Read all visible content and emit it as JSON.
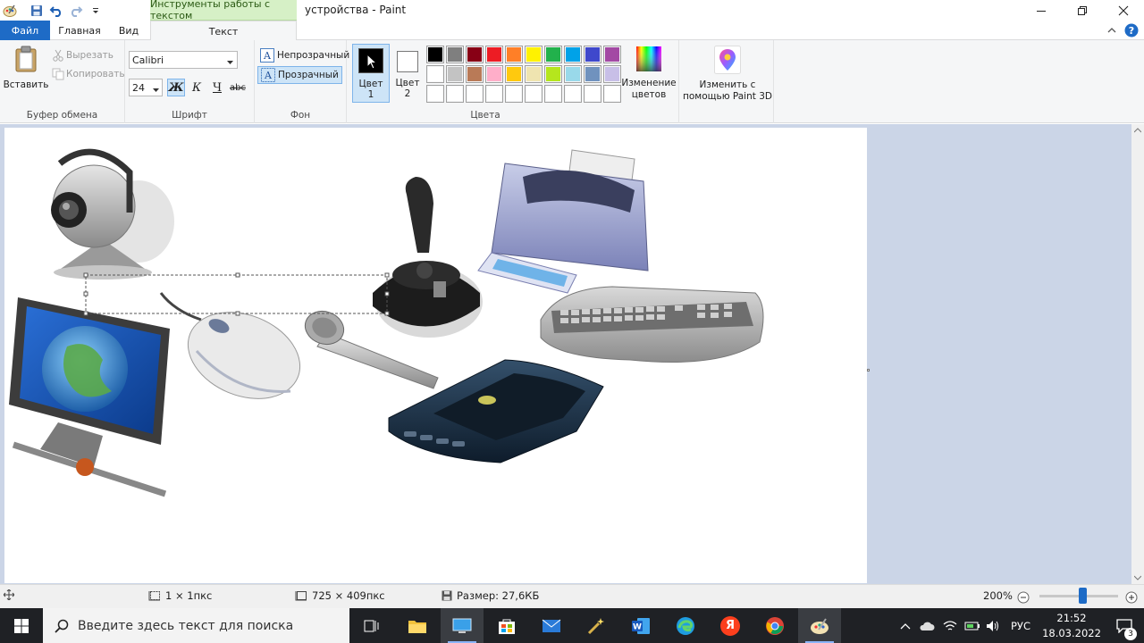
{
  "titlebar": {
    "context_tab_title": "Инструменты работы с текстом",
    "document_title": "устройства - Paint"
  },
  "tabs": {
    "file": "Файл",
    "home": "Главная",
    "view": "Вид",
    "text": "Текст"
  },
  "ribbon": {
    "clipboard": {
      "group_label": "Буфер обмена",
      "paste": "Вставить",
      "cut": "Вырезать",
      "copy": "Копировать"
    },
    "font": {
      "group_label": "Шрифт",
      "family": "Calibri",
      "size": "24",
      "bold": "Ж",
      "italic": "К",
      "underline": "Ч",
      "strike": "abc"
    },
    "background": {
      "group_label": "Фон",
      "opaque": "Непрозрачный",
      "transparent": "Прозрачный"
    },
    "colors": {
      "group_label": "Цвета",
      "color1_line1": "Цвет",
      "color1_line2": "1",
      "color2_line1": "Цвет",
      "color2_line2": "2",
      "edit_colors_line1": "Изменение",
      "edit_colors_line2": "цветов",
      "palette_row1": [
        "#000000",
        "#7f7f7f",
        "#880015",
        "#ed1c24",
        "#ff7f27",
        "#fff200",
        "#22b14c",
        "#00a2e8",
        "#3f48cc",
        "#a349a4"
      ],
      "palette_row2": [
        "#ffffff",
        "#c3c3c3",
        "#b97a57",
        "#ffaec9",
        "#ffc90e",
        "#efe4b0",
        "#b5e61d",
        "#99d9ea",
        "#7092be",
        "#c8bfe7"
      ],
      "color1_value": "#000000",
      "color2_value": "#ffffff"
    },
    "paint3d": {
      "line1": "Изменить с",
      "line2": "помощью Paint 3D"
    }
  },
  "status": {
    "selection": "1 × 1пкс",
    "image_size": "725 × 409пкс",
    "file_size": "Размер: 27,6КБ",
    "zoom": "200%",
    "zoom_slider_fraction": 0.55
  },
  "taskbar": {
    "search_placeholder": "Введите здесь текст для поиска",
    "language": "РУС",
    "time": "21:52",
    "date": "18.03.2022",
    "notifications": "3",
    "yandex": "Я"
  }
}
